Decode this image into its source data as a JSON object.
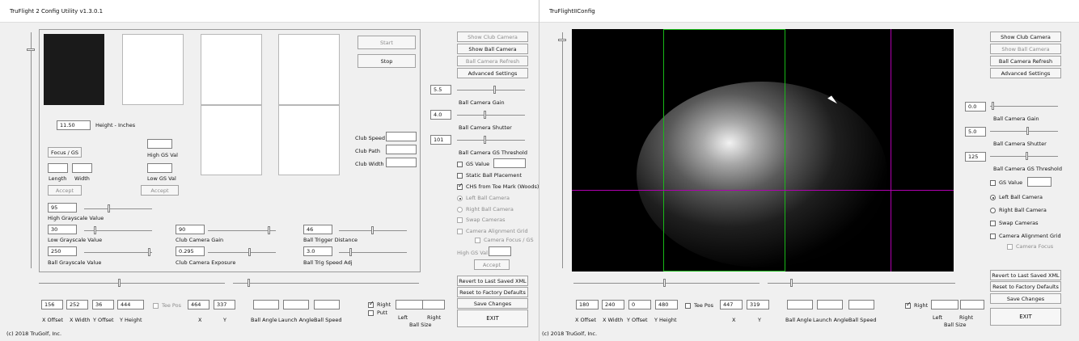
{
  "left_window": {
    "title": "TruFlight 2 Config Utility v1.3.0.1",
    "height_value": "11.50",
    "height_label": "Height - Inches",
    "focus_gs": "Focus / GS",
    "high_gs_val": "High GS Val",
    "low_gs_val": "Low GS Val",
    "length": "Length",
    "width": "Width",
    "accept_left": "Accept",
    "accept_mid": "Accept",
    "high_gray_value": "95",
    "high_gray_label": "High Grayscale Value",
    "low_gray_value": "30",
    "low_gray_label": "Low Grayscale Value",
    "ball_gray_value": "250",
    "ball_gray_label": "Ball Grayscale Value",
    "club_camera_gain_value": "90",
    "club_camera_gain_label": "Club Camera Gain",
    "club_camera_exposure_value": "0.295",
    "club_camera_exposure_label": "Club Camera Exposure",
    "ball_trigger_distance_value": "46",
    "ball_trigger_distance_label": "Ball Trigger Distance",
    "ball_trig_speed_value": "3.0",
    "ball_trig_speed_label": "Ball Trig Speed Adj",
    "start": "Start",
    "stop": "Stop",
    "club_speed": "Club Speed",
    "club_path": "Club Path",
    "club_width": "Club Width",
    "right_controls": {
      "show_club_camera": "Show Club Camera",
      "show_ball_camera": "Show Ball Camera",
      "ball_camera_refresh": "Ball Camera Refresh",
      "advanced_settings": "Advanced Settings",
      "ball_camera_gain_value": "5.5",
      "ball_camera_gain_label": "Ball Camera Gain",
      "ball_camera_shutter_value": "4.0",
      "ball_camera_shutter_label": "Ball Camera Shutter",
      "ball_camera_gs_threshold_value": "101",
      "ball_camera_gs_threshold_label": "Ball Camera GS Threshold",
      "gs_value": "GS Value",
      "static_ball_placement": "Static Ball Placement",
      "chs_from_toe_mark": "CHS from Toe Mark (Woods)",
      "left_ball_camera": "Left Ball Camera",
      "right_ball_camera": "Right Ball Camera",
      "swap_cameras": "Swap Cameras",
      "camera_alignment_grid": "Camera Alignment Grid",
      "camera_focus_gs": "Camera Focus / GS",
      "high_gs_val": "High GS Val",
      "accept": "Accept",
      "revert": "Revert to Last Saved XML",
      "reset": "Reset to Factory Defaults",
      "save": "Save Changes",
      "exit": "EXIT"
    },
    "bottom_values": {
      "x_offset": "156",
      "x_width": "252",
      "y_offset": "36",
      "y_height": "444",
      "tee_pos": "Tee Pos",
      "x": "464",
      "y": "337",
      "right": "Right",
      "putt": "Putt"
    },
    "bottom_labels": {
      "x_offset": "X Offset",
      "x_width": "X Width",
      "y_offset": "Y Offset",
      "y_height": "Y Height",
      "x": "X",
      "y": "Y",
      "ball_angle": "Ball Angle",
      "launch_angle": "Launch Angle",
      "ball_speed": "Ball Speed",
      "left": "Left",
      "right": "Right",
      "ball_size": "Ball Size"
    },
    "copyright": "(c) 2018  TruGolf, Inc."
  },
  "right_window": {
    "title": "TruFlightIIConfig",
    "buttons": {
      "show_club_camera": "Show Club Camera",
      "show_ball_camera": "Show Ball Camera",
      "ball_camera_refresh": "Ball Camera Refresh",
      "advanced_settings": "Advanced Settings",
      "revert": "Revert to Last Saved XML",
      "reset": "Reset to Factory Defaults",
      "save": "Save Changes",
      "exit": "EXIT"
    },
    "controls": {
      "ball_camera_gain_value": "0.0",
      "ball_camera_gain_label": "Ball Camera Gain",
      "ball_camera_shutter_value": "5.0",
      "ball_camera_shutter_label": "Ball Camera Shutter",
      "ball_camera_gs_threshold_value": "125",
      "ball_camera_gs_threshold_label": "Ball Camera GS Threshold",
      "gs_value": "GS Value",
      "left_ball_camera": "Left Ball Camera",
      "right_ball_camera": "Right Ball Camera",
      "swap_cameras": "Swap Cameras",
      "camera_alignment_grid": "Camera Alignment Grid",
      "camera_focus": "Camera Focus"
    },
    "bottom_values": {
      "x_offset": "180",
      "x_width": "240",
      "y_offset": "0",
      "y_height": "480",
      "tee_pos": "Tee Pos",
      "x": "447",
      "y": "319",
      "right": "Right"
    },
    "bottom_labels": {
      "x_offset": "X Offset",
      "x_width": "X Width",
      "y_offset": "Y Offset",
      "y_height": "Y Height",
      "x": "X",
      "y": "Y",
      "ball_angle": "Ball Angle",
      "launch_angle": "Launch Angle",
      "ball_speed": "Ball Speed",
      "left": "Left",
      "right": "Right",
      "ball_size": "Ball Size"
    },
    "copyright": "(c) 2018  TruGolf, Inc."
  },
  "colors": {
    "green_line": "#18b818",
    "magenta_line": "#b000b0",
    "background": "#f0f0f0"
  }
}
